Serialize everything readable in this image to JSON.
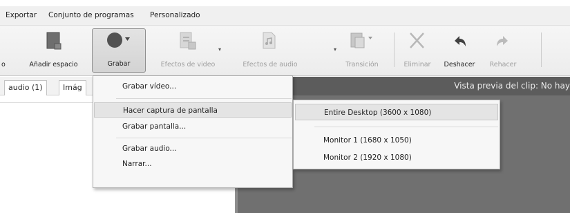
{
  "menubar": {
    "items": [
      "Exportar",
      "Conjunto de programas",
      "Personalizado"
    ]
  },
  "toolbar": {
    "cut_label": "o",
    "add_space": "Añadir espacio",
    "record": "Grabar",
    "video_effects": "Efectos de video",
    "audio_effects": "Efectos de audio",
    "transition": "Transición",
    "delete": "Eliminar",
    "undo": "Deshacer",
    "redo": "Rehacer"
  },
  "tabs": [
    "audio (1)",
    "Imág"
  ],
  "preview": {
    "title": "Vista previa del clip: No hay"
  },
  "record_menu": {
    "items": [
      "Grabar vídeo...",
      "Hacer captura de pantalla",
      "Grabar pantalla...",
      "Grabar audio...",
      "Narrar..."
    ]
  },
  "screenshot_submenu": {
    "items": [
      "Entire Desktop (3600 x 1080)",
      "Monitor 1 (1680 x 1050)",
      "Monitor 2 (1920 x 1080)"
    ]
  }
}
